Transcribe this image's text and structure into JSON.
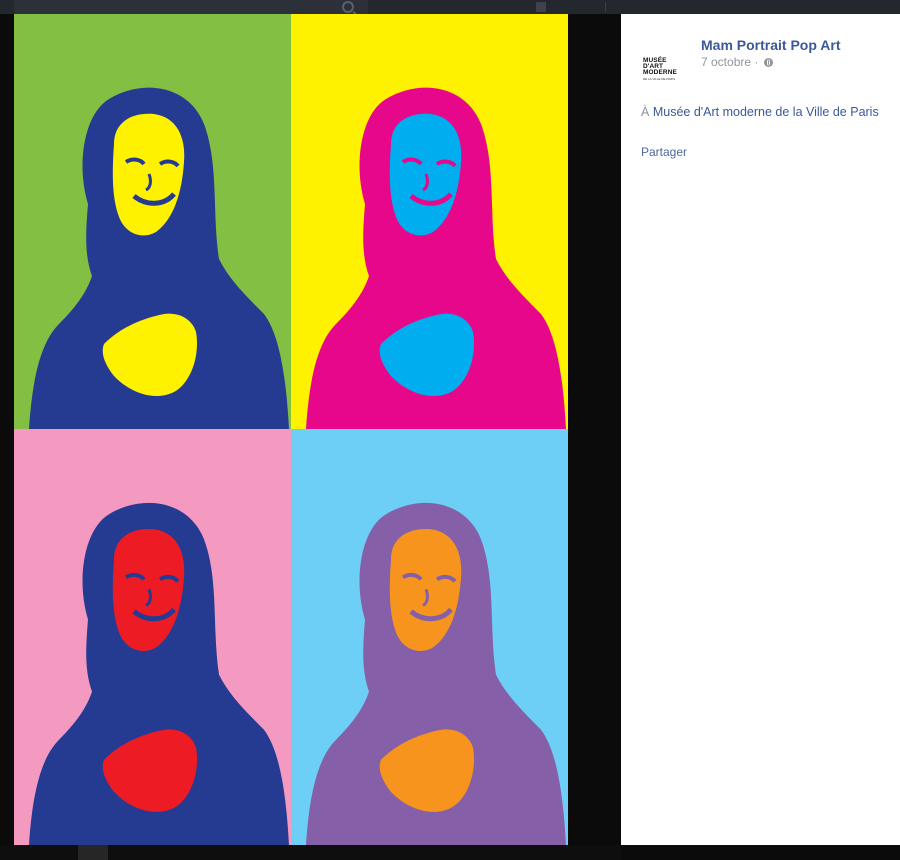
{
  "topbar": {
    "search_placeholder": "",
    "nav_item_1": "",
    "nav_item_2": ""
  },
  "photo": {
    "panels": [
      {
        "position": "top-left",
        "background": "#82bf42",
        "figure": "#253a91",
        "highlight": "#fff200"
      },
      {
        "position": "top-right",
        "background": "#fff200",
        "figure": "#e6078b",
        "highlight": "#00aeef"
      },
      {
        "position": "bottom-left",
        "background": "#f49ac1",
        "figure": "#253a91",
        "highlight": "#ed1c24"
      },
      {
        "position": "bottom-right",
        "background": "#6dcff6",
        "figure": "#8560a8",
        "highlight": "#f7941d"
      }
    ]
  },
  "sidebar": {
    "logo_icon": "mam-logo-icon",
    "logo_text_lines": [
      "MUSÉE",
      "D'ART",
      "MODERNE"
    ],
    "logo_subtext": "DE LA VILLE DE PARIS",
    "page_name": "Mam Portrait Pop Art",
    "date": "7 octobre",
    "separator": "·",
    "audience_icon": "globe-icon",
    "location_prefix": "À",
    "location_name": "Musée d'Art moderne de la Ville de Paris",
    "share_label": "Partager"
  },
  "colors": {
    "link": "#3b5998",
    "muted": "#90949c",
    "overlay": "#0b0b0b"
  }
}
